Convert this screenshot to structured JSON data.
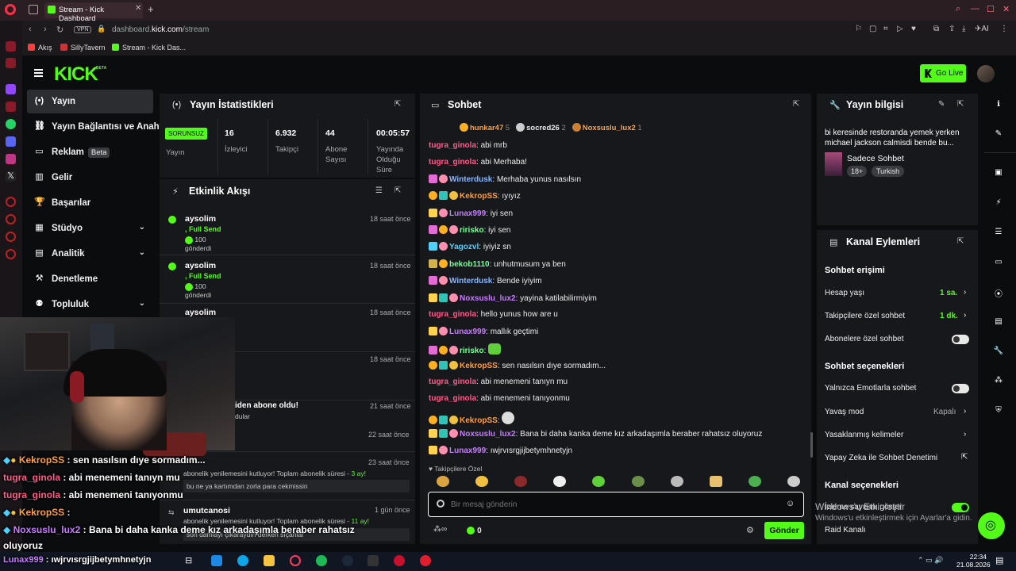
{
  "browser": {
    "tab_title": "Stream - Kick Dashboard",
    "vpn": "VPN",
    "url_prefix": "dashboard.",
    "url_domain": "kick.com",
    "url_path": "/stream",
    "bookmarks": [
      "Akış",
      "SillyTavern",
      "Stream - Kick Das..."
    ],
    "ai_label": "AI"
  },
  "header": {
    "logo": "KICK",
    "beta": "BETA",
    "go_live": "Go Live"
  },
  "sidebar": {
    "items": [
      {
        "label": "Yayın",
        "icon": "(•)"
      },
      {
        "label": "Yayın Bağlantısı ve Anahtarı",
        "icon": "⛓"
      },
      {
        "label": "Reklam",
        "icon": "▭",
        "badge": "Beta"
      },
      {
        "label": "Gelir",
        "icon": "▥"
      },
      {
        "label": "Başarılar",
        "icon": "🏆"
      },
      {
        "label": "Stüdyo",
        "icon": "▦",
        "chevron": "⌄"
      },
      {
        "label": "Analitik",
        "icon": "▤",
        "chevron": "⌄"
      },
      {
        "label": "Denetleme",
        "icon": "⚒"
      },
      {
        "label": "Topluluk",
        "icon": "⚉",
        "chevron": "⌄"
      }
    ]
  },
  "stats": {
    "title": "Yayın İstatistikleri",
    "status": "SORUNSUZ",
    "status_label": "Yayın",
    "items": [
      {
        "value": "16",
        "label": "İzleyici"
      },
      {
        "value": "6.932",
        "label": "Takipçi"
      },
      {
        "value": "44",
        "label": "Abone Sayısı"
      },
      {
        "value": "00:05:57",
        "label": "Yayında Olduğu Süre"
      }
    ]
  },
  "activity": {
    "title": "Etkinlik Akışı",
    "items": [
      {
        "name": "aysolim",
        "sub": ", Full Send",
        "amount": "100",
        "gift": "gönderdi",
        "time": "18 saat önce"
      },
      {
        "name": "aysolim",
        "sub": ", Full Send",
        "amount": "100",
        "gift": "gönderdi",
        "time": "18 saat önce"
      },
      {
        "name": "aysolim",
        "time": "18 saat önce"
      },
      {
        "time": "18 saat önce"
      },
      {
        "name": "iden abone oldu!",
        "sub2": "dular",
        "time": "21 saat önce"
      },
      {
        "time": "22 saat önce"
      },
      {
        "name": "",
        "time": "23 saat önce",
        "text": "abonelik yenilemesini kutluyor! Toplam abonelik süresi - ",
        "months": "3 ay!",
        "msg": "bu ne ya kartımdan zorla para cekmissin"
      },
      {
        "name": "umutcanosi",
        "time": "1 gün önce",
        "text": "abonelik yenilemesini kutluyor! Toplam abonelik süresi - ",
        "months": "11 ay!",
        "msg": "son damlayı çıkaraydın derken sıçanlar"
      }
    ]
  },
  "chat": {
    "title": "Sohbet",
    "top": [
      {
        "name": "hunkar47",
        "n": "5",
        "color": "#ff9f43"
      },
      {
        "name": "socred26",
        "n": "2",
        "color": "#e7e8ea"
      },
      {
        "name": "Noxsuslu_lux2",
        "n": "1",
        "color": "#ff9f43"
      }
    ],
    "messages": [
      {
        "user": "tugra_ginola",
        "color": "#ff5c8a",
        "text": "abi mrb"
      },
      {
        "user": "tugra_ginola",
        "color": "#ff5c8a",
        "text": "abi Merhaba!"
      },
      {
        "user": "Winterdusk",
        "color": "#8ab4ff",
        "text": "Merhaba yunus nasılsın"
      },
      {
        "user": "KekropSS",
        "color": "#ff9f43",
        "text": "ıyıyız"
      },
      {
        "user": "Lunax999",
        "color": "#c77dff",
        "text": "iyi sen"
      },
      {
        "user": "ririsko",
        "color": "#7bff9a",
        "text": "iyi sen"
      },
      {
        "user": "Yagozvl",
        "color": "#4fd1ff",
        "text": "iyiyiz sn"
      },
      {
        "user": "bekob1110",
        "color": "#7bff9a",
        "text": "unhutmusum ya ben"
      },
      {
        "user": "Winterdusk",
        "color": "#8ab4ff",
        "text": "Bende iyiyim"
      },
      {
        "user": "Noxsuslu_lux2",
        "color": "#c77dff",
        "text": "yayina katilabilirmiyim"
      },
      {
        "user": "tugra_ginola",
        "color": "#ff5c8a",
        "text": "hello yunus how are u"
      },
      {
        "user": "Lunax999",
        "color": "#c77dff",
        "text": "mallık geçtimi"
      },
      {
        "user": "ririsko",
        "color": "#7bff9a",
        "text": ""
      },
      {
        "user": "KekropSS",
        "color": "#ff9f43",
        "text": "sen nasılsın dıye sormadım..."
      },
      {
        "user": "tugra_ginola",
        "color": "#ff5c8a",
        "text": "abi menemeni tanıyn mu"
      },
      {
        "user": "tugra_ginola",
        "color": "#ff5c8a",
        "text": "abi menemeni tanıyonmu"
      },
      {
        "user": "KekropSS",
        "color": "#ff9f43",
        "text": ""
      },
      {
        "user": "Noxsuslu_lux2",
        "color": "#c77dff",
        "text": "Bana bi daha kanka deme kız arkadaşımla beraber rahatsız oluyoruz"
      },
      {
        "user": "Lunax999",
        "color": "#c77dff",
        "text": "ıwjrvısrgjijbetymhnetyjn"
      }
    ],
    "emote_label": "Takipçilere Özel",
    "placeholder": "Bir mesaj gönderin",
    "send": "Gönder",
    "count": "0"
  },
  "info": {
    "title": "Yayın bilgisi",
    "stream_title": "bi keresinde restoranda yemek yerken michael jackson calmisdi bende bu...",
    "mode": "Sadece Sohbet",
    "tags": [
      "18+",
      "Turkish"
    ]
  },
  "actions": {
    "title": "Kanal Eylemleri",
    "chat_access": "Sohbet erişimi",
    "rows1": [
      {
        "label": "Hesap yaşı",
        "value": "1 sa."
      },
      {
        "label": "Takipçilere özel sohbet",
        "value": "1 dk."
      },
      {
        "label": "Abonelere özel sohbet",
        "toggle": false
      }
    ],
    "chat_options": "Sohbet seçenekleri",
    "rows2": [
      {
        "label": "Yalnızca Emotlarla sohbet",
        "toggle": false
      },
      {
        "label": "Yavaş mod",
        "value": "Kapalı"
      },
      {
        "label": "Yasaklanmış kelimeler"
      },
      {
        "label": "Yapay Zeka ile Sohbet Denetimi"
      }
    ],
    "channel_options": "Kanal seçenekleri",
    "rows3": [
      {
        "label": "İzleme sayısını göster",
        "toggle": true
      },
      {
        "label": "Raid Kanalı"
      }
    ]
  },
  "watermark": {
    "line1": "Windows'u Etkinleştir",
    "line2": "Windows'u etkinleştirmek için Ayarlar'a gidin."
  },
  "overlay": [
    {
      "user": "KekropSS",
      "color": "#ff9f43",
      "text": " : sen nasılsın dıye sormadım..."
    },
    {
      "user": "tugra_ginola",
      "color": "#ff5c8a",
      "text": " : abi menemeni tanıyn mu"
    },
    {
      "user": "tugra_ginola",
      "color": "#ff5c8a",
      "text": " : abi menemeni tanıyonmu"
    },
    {
      "user": "KekropSS",
      "color": "#ff9f43",
      "text": " :"
    },
    {
      "user": "Noxsuslu_lux2",
      "color": "#c77dff",
      "text": " : Bana bi daha kanka deme kız arkadaşımla beraber rahatsız"
    },
    {
      "user": "",
      "color": "#fff",
      "text": "oluyoruz"
    },
    {
      "user": "Lunax999",
      "color": "#c77dff",
      "text": " : ıwjrvısrgjijbetymhnetyjn"
    }
  ],
  "taskbar": {
    "time": "22:34",
    "date": "21.08.2026"
  }
}
